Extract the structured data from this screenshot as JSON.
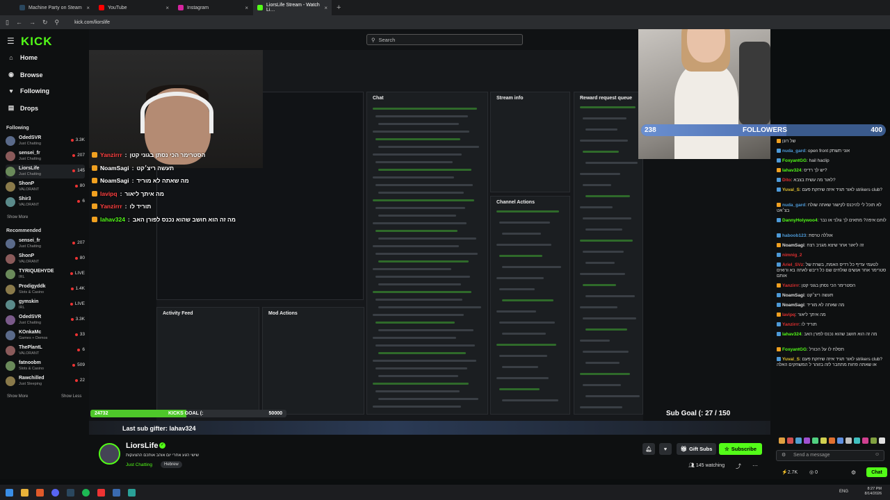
{
  "browser": {
    "tabs": [
      {
        "label": "Machine Party on Steam",
        "color": "#2a475e",
        "active": false
      },
      {
        "label": "YouTube",
        "color": "#ff0000",
        "active": false
      },
      {
        "label": "Instagram",
        "color": "#d6249f",
        "active": false
      },
      {
        "label": "LiorsLife Stream - Watch Li…",
        "color": "#53fc18",
        "active": true
      }
    ],
    "url": "kick.com/liorslife",
    "new_tab_glyph": "+"
  },
  "header": {
    "logo": "KICK",
    "search_placeholder": "Search"
  },
  "nav": {
    "items": [
      {
        "label": "Home",
        "icon": "⌂"
      },
      {
        "label": "Browse",
        "icon": "◉"
      },
      {
        "label": "Following",
        "icon": "♥"
      },
      {
        "label": "Drops",
        "icon": "▤"
      }
    ]
  },
  "sidebar": {
    "following_title": "Following",
    "following": [
      {
        "name": "OdedSVR",
        "game": "Just Chatting",
        "viewers": "3.3K"
      },
      {
        "name": "sensei_fr",
        "game": "Just Chatting",
        "viewers": "207"
      },
      {
        "name": "LiorsLife",
        "game": "Just Chatting",
        "viewers": "145"
      },
      {
        "name": "ShonP",
        "game": "VALORANT",
        "viewers": "80"
      },
      {
        "name": "Shir3",
        "game": "VALORANT",
        "viewers": "6"
      }
    ],
    "show_more": "Show More",
    "recommended_title": "Recommended",
    "recommended": [
      {
        "name": "sensei_fr",
        "game": "Just Chatting",
        "viewers": "207"
      },
      {
        "name": "ShonP",
        "game": "VALORANT",
        "viewers": "80"
      },
      {
        "name": "TYRIQUEHYDE",
        "game": "IRL",
        "viewers": "LIVE"
      },
      {
        "name": "Prodigyddk",
        "game": "Slots & Casino",
        "viewers": "1.4K"
      },
      {
        "name": "gymskin",
        "game": "IRL",
        "viewers": "LIVE"
      },
      {
        "name": "OdedSVR",
        "game": "Just Chatting",
        "viewers": "3.3K"
      },
      {
        "name": "KOnkaMc",
        "game": "Games + Demos",
        "viewers": "33"
      },
      {
        "name": "ThePlantL",
        "game": "VALORANT",
        "viewers": "6"
      },
      {
        "name": "fatnoobm",
        "game": "Slots & Casino",
        "viewers": "509"
      },
      {
        "name": "Rawchilled",
        "game": "Just Sleeping",
        "viewers": "22"
      }
    ],
    "show_more_2": "Show More",
    "show_less": "Show Less"
  },
  "overlay": {
    "chat_lines": [
      {
        "user": "Yanzirrr",
        "text": "הסטרימר הכי נסתן בגוני קטן",
        "color": "red"
      },
      {
        "user": "NoamSagi",
        "text": "תעשה ריצ׳קט",
        "color": "white"
      },
      {
        "user": "NoamSagi",
        "text": "מה שאתה לא מוריד",
        "color": "white"
      },
      {
        "user": "lavipq",
        "text": "מה איתך ליאור",
        "color": "red"
      },
      {
        "user": "Yanzirrr",
        "text": "תוריד לו",
        "color": "red"
      },
      {
        "user": "lahav324",
        "text": "מה זה הוא חושב שהוא נכנס לפורן האב",
        "color": "green"
      }
    ],
    "panels": {
      "chat": "Chat",
      "stream_info": "Stream info",
      "reward_queue": "Reward request queue",
      "channel_actions": "Channel Actions",
      "activity_feed": "Activity Feed",
      "mod_actions": "Mod Actions"
    },
    "goal": {
      "current": "24732",
      "label": "KICKS GOAL (:",
      "target": "50000",
      "progress": 0.49
    },
    "last_sub": "Last sub gifter: lahav324",
    "followers": {
      "current": "238",
      "label": "FOLLOWERS",
      "target": "400",
      "progress": 0.595
    },
    "sub_goal": "Sub Goal (: 27 / 150"
  },
  "chat": {
    "messages": [
      {
        "user": "",
        "text": "של רונן",
        "color": "#dddddd"
      },
      {
        "user": "nuda_gard",
        "text": ": open front אוני תשתק",
        "color": "#4d9ad8"
      },
      {
        "user": "FoxyantGG",
        "text": ": hail haclip",
        "color": "#53fc18"
      },
      {
        "user": "lahav324",
        "text": ": יש לך רדיס?",
        "color": "#53fc18"
      },
      {
        "user": "Dito",
        "text": ": לאור מה עשית בצבא?",
        "color": "#e03030"
      },
      {
        "user": "Yuval_S",
        "text": ": לאור תגיד איזה שיחקת פעם strikers club?",
        "color": "#e0c030"
      },
      {
        "user": "nuda_gard",
        "text": ": לא תוכל לי להיכנס לקישור שאתה שולח בצ׳אט",
        "color": "#4d9ad8"
      },
      {
        "user": "DannyHolywoo4",
        "text": ": לוחם איפה? מתאים לך גולני או נבר",
        "color": "#53fc18"
      },
      {
        "user": "haboob123",
        "text": ": אוללה טרסת",
        "color": "#4d9ad8"
      },
      {
        "user": "NoamSagi",
        "text": ": זה ליאור אחר שיצא מגניב רצח",
        "color": "#dddddd"
      },
      {
        "user": "nimnig_2",
        "text": "",
        "color": "#e03030"
      },
      {
        "user": "Ariel_SVz",
        "text": ": לטעמי עדיף כל רדיס האמת, בשרת של סטרימר אחר אנשים שולחים שם כל דיבש לאתה בא ורואים אותם",
        "color": "#e03030"
      },
      {
        "user": "Yanzirrr",
        "text": ": הסטרימר הכי נסתן בגוני קטן",
        "color": "#e03030"
      },
      {
        "user": "NoamSagi",
        "text": ": תעשה ריצ׳קט",
        "color": "#dddddd"
      },
      {
        "user": "NoamSagi",
        "text": ": מה שאתה לא מוריד",
        "color": "#dddddd"
      },
      {
        "user": "lavipq",
        "text": ": מה איתך ליאור",
        "color": "#e03030"
      },
      {
        "user": "Yanzirrr",
        "text": ": תוריד לו",
        "color": "#e03030"
      },
      {
        "user": "lahav324",
        "text": ": מה זה הוא חושב שהוא נכנס לפורן האב",
        "color": "#53fc18"
      },
      {
        "user": "FoxyantGG",
        "text": ": תסלח לו על הכורל",
        "color": "#53fc18"
      },
      {
        "user": "Yuval_S",
        "text": ": לאור תגיד איזה שיחקת פעם strikers club? או שאתה פחות מתחבר לזה בזוהר ל המשחקים האלה",
        "color": "#e0c030"
      }
    ],
    "send_placeholder": "Send a message",
    "kicks": "2.7K",
    "zero": "0",
    "chat_button": "Chat"
  },
  "channel": {
    "name": "LiorsLife",
    "title": "שישי רגוע אחרי יום אוהב אותכם ההצעקות",
    "category": "Just Chatting",
    "tag": "Hebrew",
    "gift_subs": "Gift Subs",
    "subscribe": "Subscribe",
    "watching": "145 watching"
  },
  "taskbar": {
    "time": "8:27 PM",
    "date": "8/14/2026",
    "lang": "ENG"
  },
  "colors": {
    "brand": "#53fc18",
    "live": "#e33333"
  }
}
